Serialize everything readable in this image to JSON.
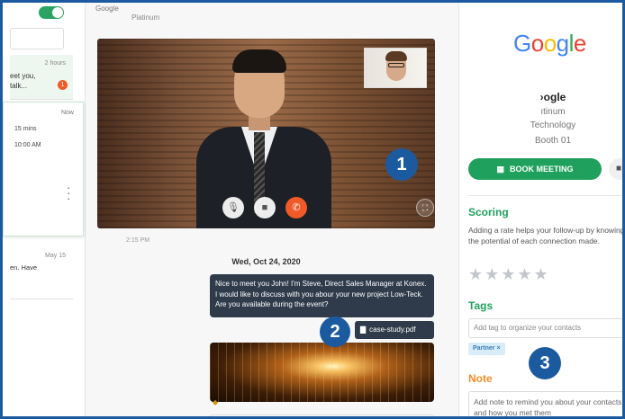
{
  "left_panel": {
    "conv1": {
      "time": "2 hours",
      "preview": "eet you,\ntalk...",
      "badge": "1"
    },
    "active_card": {
      "time": "Now",
      "duration": "15 mins",
      "clock": "10:00 AM"
    },
    "conv3": {
      "time": "May 15",
      "preview": "en. Have"
    }
  },
  "header": {
    "logo_text": "Google",
    "tier": "Platinum"
  },
  "video": {
    "controls": [
      "microphone-icon",
      "camera-icon",
      "end-call-icon"
    ],
    "fullscreen_icon": "expand-icon"
  },
  "chat": {
    "timestamp": "2:15 PM",
    "date": "Wed, Oct 24, 2020",
    "message": "Nice to meet you John! I'm Steve, Direct Sales Manager at Konex. I would like to discuss with you abour your new project Low-Teck. Are you available during the event?",
    "file_name": "case-study.pdf"
  },
  "profile": {
    "logo_letters": [
      "G",
      "o",
      "o",
      "g",
      "l",
      "e"
    ],
    "company": "›ogle",
    "tier": "ıtinum",
    "category": "Technology",
    "booth": "Booth 01",
    "book_label": "BOOK MEETING"
  },
  "scoring": {
    "title": "Scoring",
    "description": "Adding a rate helps your follow-up by knowing the potential of each connection made.",
    "stars": "★★★★★"
  },
  "tags": {
    "title": "Tags",
    "placeholder": "Add tag to organize your contacts",
    "chip": "Partner ×"
  },
  "note": {
    "title": "Note",
    "placeholder": "Add note to remind you about your contacts and how you met them"
  },
  "steps": [
    "1",
    "2",
    "3"
  ],
  "colors": {
    "frame": "#1c5aa0",
    "green": "#1fa05c",
    "orange": "#f28c28",
    "end_call": "#f05a28",
    "chat_bubble": "#2f3b4a"
  }
}
